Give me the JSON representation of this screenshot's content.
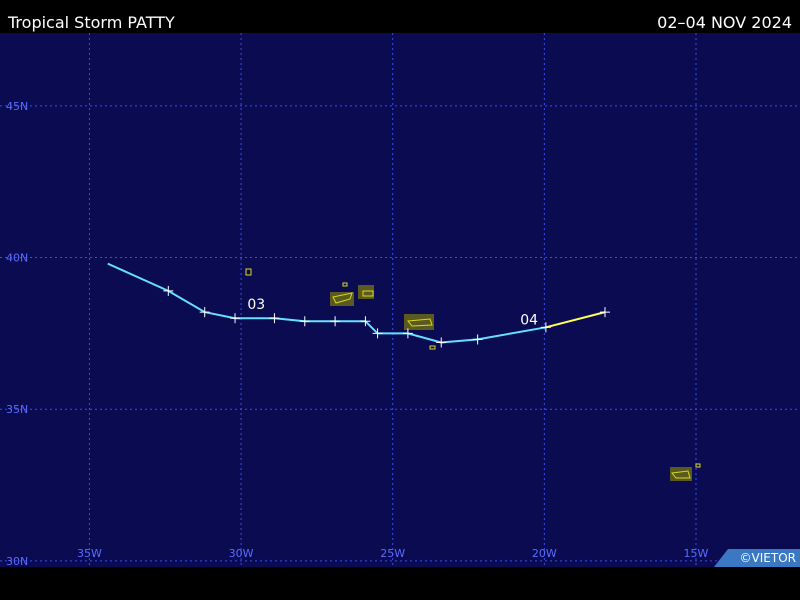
{
  "header": {
    "title": "Tropical Storm PATTY",
    "dates": "02–04 NOV 2024"
  },
  "credit": "©VIETOR",
  "colors": {
    "ocean": "#0b0b52",
    "grid": "#3a4cf0",
    "grid_label": "#5a6cff",
    "land_fill": "#5a5a1e",
    "land_outline": "#d8d820",
    "track_storm": "#66e0ff",
    "track_depression": "#ffff55"
  },
  "map": {
    "lon_min": -37.95,
    "lon_max": -11.57,
    "lat_min": 29.8,
    "lat_max": 47.4,
    "lat_labels": [
      {
        "lat": 45,
        "text": "45N"
      },
      {
        "lat": 40,
        "text": "40N"
      },
      {
        "lat": 35,
        "text": "35N"
      },
      {
        "lat": 30,
        "text": "30N"
      }
    ],
    "lon_labels": [
      {
        "lon": -35,
        "text": "35W"
      },
      {
        "lon": -30,
        "text": "30W"
      },
      {
        "lon": -25,
        "text": "25W"
      },
      {
        "lon": -20,
        "text": "20W"
      },
      {
        "lon": -15,
        "text": "15W"
      }
    ]
  },
  "track": {
    "storm_points": [
      [
        -34.4,
        39.8
      ],
      [
        -32.4,
        38.9
      ],
      [
        -31.2,
        38.2
      ],
      [
        -30.2,
        38.0
      ],
      [
        -28.9,
        38.0
      ],
      [
        -27.9,
        37.9
      ],
      [
        -26.9,
        37.9
      ],
      [
        -25.9,
        37.9
      ],
      [
        -25.5,
        37.5
      ],
      [
        -24.5,
        37.5
      ],
      [
        -23.4,
        37.2
      ],
      [
        -22.2,
        37.3
      ],
      [
        -19.95,
        37.7
      ]
    ],
    "depression_points": [
      [
        -19.95,
        37.7
      ],
      [
        -18.0,
        38.2
      ]
    ],
    "day_labels": [
      {
        "text": "03",
        "lon": -29.5,
        "lat": 38.3
      },
      {
        "text": "04",
        "lon": -20.5,
        "lat": 37.8
      }
    ]
  }
}
